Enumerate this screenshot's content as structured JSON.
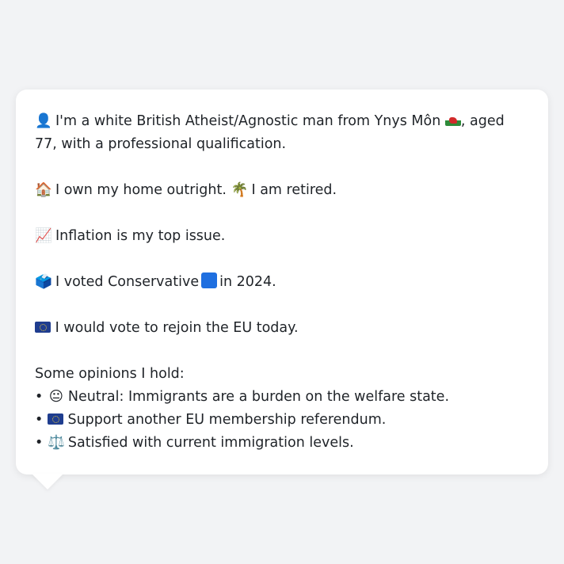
{
  "profile": {
    "identity": {
      "icon": "person-silhouette-icon",
      "text_before_flag": "I'm a white British Atheist/Agnostic man from Ynys Môn",
      "flag": "wales-flag-icon",
      "text_after_flag": ", aged 77, with a professional qualification."
    },
    "housing": {
      "icon": "house-icon",
      "text": "I own my home outright.",
      "second_icon": "palm-tree-icon",
      "second_text": "I am retired."
    },
    "issue": {
      "icon": "chart-increasing-icon",
      "text": "Inflation is my top issue."
    },
    "vote": {
      "icon": "ballot-box-icon",
      "text_before": "I voted Conservative",
      "party_color_icon": "blue-square-icon",
      "party_color": "#1f6fe0",
      "text_after": "in 2024."
    },
    "eu": {
      "icon": "eu-flag-icon",
      "text": "I would vote to rejoin the EU today."
    },
    "opinions_heading": "Some opinions I hold:",
    "opinions": [
      {
        "bullet": "•",
        "icon": "neutral-face-icon",
        "glyph": "😐",
        "text": "Neutral: Immigrants are a burden on the welfare state."
      },
      {
        "bullet": "•",
        "icon": "eu-flag-icon",
        "glyph": "",
        "text": "Support another EU membership referendum."
      },
      {
        "bullet": "•",
        "icon": "balance-scale-icon",
        "glyph": "⚖️",
        "text": "Satisfied with current immigration levels."
      }
    ]
  },
  "glyphs": {
    "person": "👤",
    "house": "🏠",
    "palm": "🌴",
    "chart": "📈",
    "ballot": "🗳️"
  }
}
